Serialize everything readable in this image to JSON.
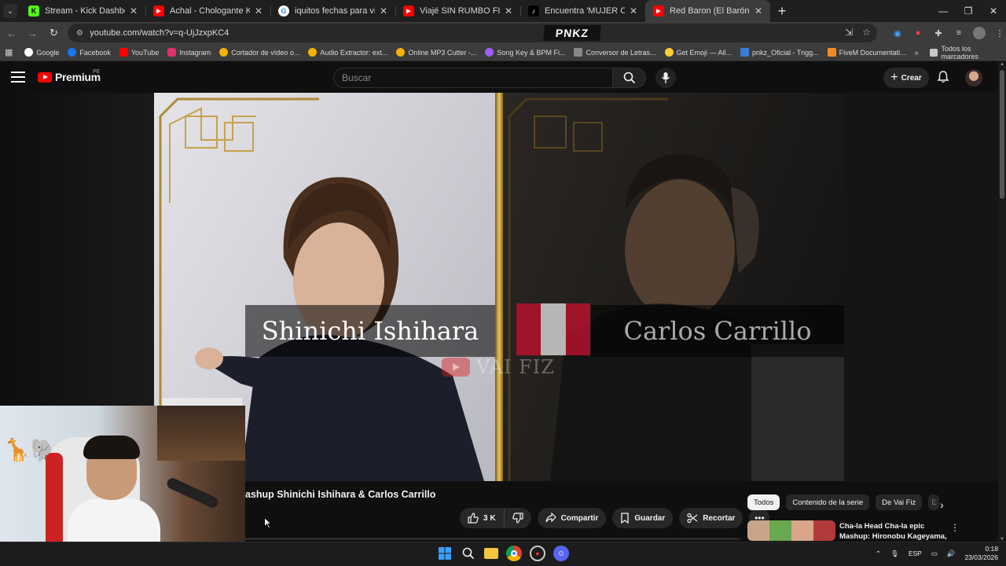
{
  "browser": {
    "tabs": [
      {
        "title": "Stream - Kick Dashboard",
        "favicon_color": "#53fc18",
        "favicon_letter": "K"
      },
      {
        "title": "Achal - Chologante KARAOKE (",
        "favicon_color": "#ff0000",
        "favicon_letter": "▶"
      },
      {
        "title": "iquitos fechas para viajar - Busca",
        "favicon_color": "#ffffff",
        "favicon_letter": "G"
      },
      {
        "title": "Viajé SIN RUMBO FIJO al Coraz",
        "favicon_color": "#ff0000",
        "favicon_letter": "▶"
      },
      {
        "title": "Encuentra 'MUJER CANTA ORA",
        "favicon_color": "#000000",
        "favicon_letter": "♪"
      },
      {
        "title": "Red Baron (El Barón Rojo) oper",
        "favicon_color": "#ff0000",
        "favicon_letter": "▶",
        "active": true
      }
    ],
    "new_tab": "+",
    "url": "youtube.com/watch?v=q-UjJzxpKC4",
    "overlay_logo": "PNKZ",
    "bookmarks": [
      {
        "label": "Google",
        "color": "#ffffff"
      },
      {
        "label": "Facebook",
        "color": "#1877f2"
      },
      {
        "label": "YouTube",
        "color": "#ff0000"
      },
      {
        "label": "Instagram",
        "color": "#e1306c"
      },
      {
        "label": "Cortador de vídeo o...",
        "color": "#f4b400"
      },
      {
        "label": "Audio Extractor: ext...",
        "color": "#f4b400"
      },
      {
        "label": "Online MP3 Cutter -...",
        "color": "#f4b400"
      },
      {
        "label": "Song Key & BPM Fi...",
        "color": "#a05cff"
      },
      {
        "label": "Conversor de Letras...",
        "color": "#888888"
      },
      {
        "label": "Get Emoji — All...",
        "color": "#ffcc33"
      },
      {
        "label": "pnkz_Oficial - Trigg...",
        "color": "#3a7bd5"
      },
      {
        "label": "FiveM Documentati...",
        "color": "#f28c28"
      }
    ],
    "bookmarks_more": "»",
    "all_bookmarks": "Todos los marcadores"
  },
  "youtube": {
    "logo_text": "Premium",
    "country": "PE",
    "search_placeholder": "Buscar",
    "create_label": "Crear",
    "video": {
      "left_name": "Shinichi Ishihara",
      "right_name": "Carlos Carrillo",
      "watermark": "VAI FIZ"
    },
    "title": "ashup Shinichi Ishihara & Carlos Carrillo",
    "likes": "3 K",
    "share_label": "Compartir",
    "save_label": "Guardar",
    "clip_label": "Recortar",
    "chips": [
      "Todos",
      "Contenido de la serie",
      "De Vai Fiz",
      "E"
    ],
    "recommended": {
      "title": "Cha-la Head Cha-la epic Mashup: Hironobu Kageyama, ..."
    }
  },
  "taskbar": {
    "language": "ESP",
    "time": "0:18",
    "date": "23/03/2026"
  }
}
